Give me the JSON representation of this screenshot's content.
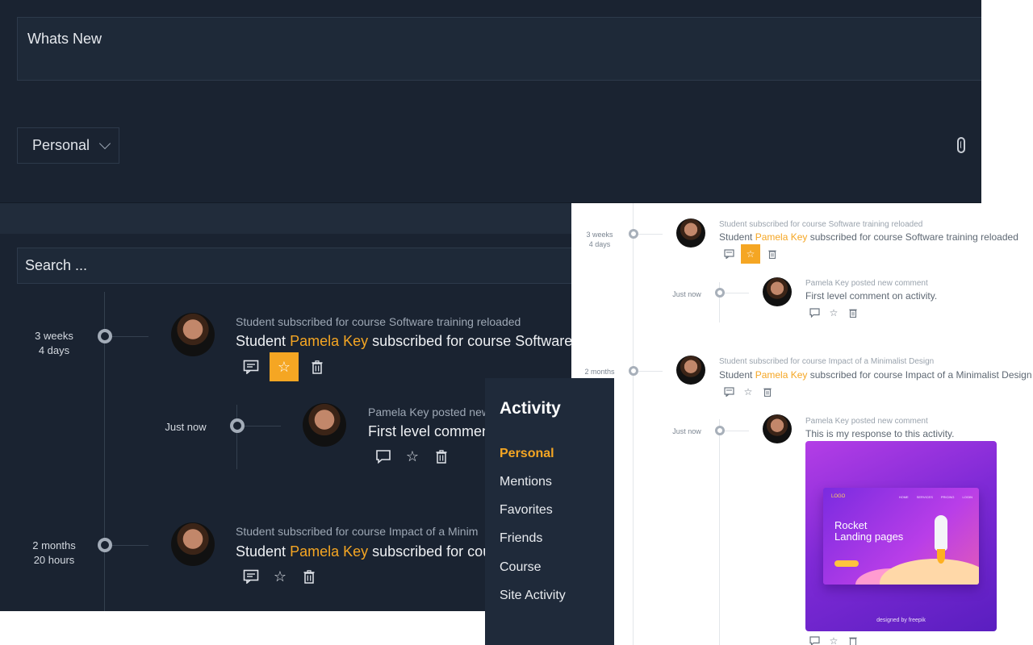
{
  "composer": {
    "placeholder": "Whats New",
    "privacy_value": "Personal"
  },
  "search": {
    "placeholder": "Search ..."
  },
  "activities": [
    {
      "time_line1": "3 weeks",
      "time_line2": "4 days",
      "meta": "Student subscribed for course Software training reloaded",
      "title_prefix": "Student ",
      "title_user": "Pamela Key",
      "title_suffix": " subscribed for course Software training reloaded",
      "favorited": true,
      "reply": {
        "time": "Just now",
        "meta": "Pamela Key posted new comment",
        "text": "First level comment on activity."
      }
    },
    {
      "time_line1": "2 months",
      "time_line2": "20 hours",
      "meta": "Student subscribed for course Impact of a Minimalist Design",
      "title_prefix": "Student ",
      "title_user": "Pamela Key",
      "title_suffix": " subscribed for course Impact of a Minimalist Design",
      "favorited": false,
      "reply": {
        "time": "Just now",
        "meta": "Pamela Key posted new comment",
        "text": "This is my response to this activity."
      }
    }
  ],
  "dark_truncated": {
    "title_1_suffix": " subscribed for course Software",
    "reply_meta": "Pamela Key posted new",
    "reply_text": "First level commen",
    "meta_2": "Student subscribed for course Impact of a Minim",
    "title_2_suffix": " subscribed for cou"
  },
  "light_time_2": "2 months",
  "promo_image": {
    "headline_line1": "Rocket",
    "headline_line2": "Landing pages",
    "logo": "LOGO",
    "nav": [
      "HOME",
      "SERVICES",
      "PRICING",
      "LOGIN"
    ],
    "credit": "designed by freepik"
  },
  "activity_nav": {
    "title": "Activity",
    "items": [
      "Personal",
      "Mentions",
      "Favorites",
      "Friends",
      "Course",
      "Site Activity"
    ],
    "active_index": 0
  },
  "colors": {
    "accent": "#f5a623",
    "dark_bg": "#1a2331",
    "nav_bg": "#1f2a3a"
  },
  "icons": {
    "comment": "comment-icon",
    "star": "star-icon",
    "delete": "trash-icon",
    "attach": "paperclip-icon",
    "dropdown": "chevron-down-icon"
  }
}
